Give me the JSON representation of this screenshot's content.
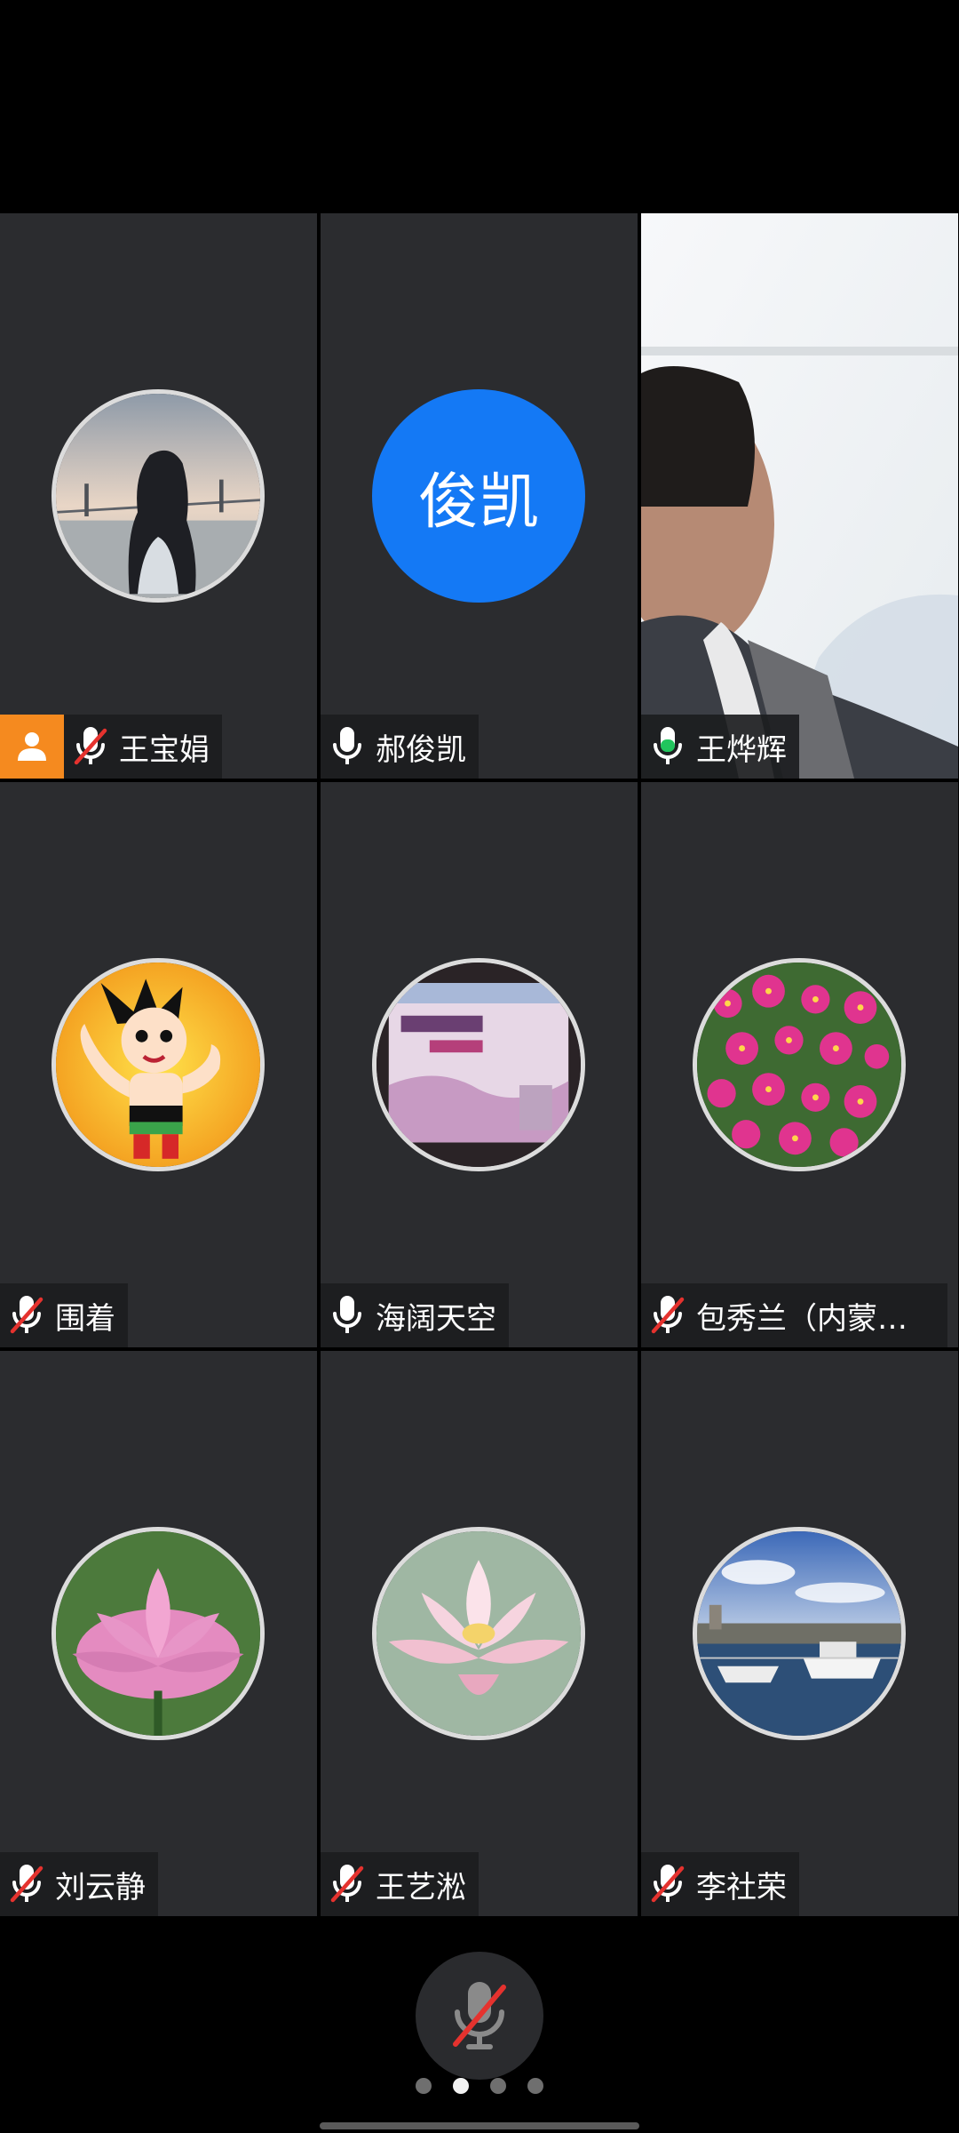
{
  "participants": [
    {
      "name": "王宝娟",
      "mic": "muted",
      "host": true,
      "avatar": "photo-girl-bridge-icon"
    },
    {
      "name": "郝俊凯",
      "mic": "on",
      "host": false,
      "avatar_initials": "俊凯"
    },
    {
      "name": "王烨辉",
      "mic": "speaking",
      "host": false,
      "video": true
    },
    {
      "name": "围着",
      "mic": "muted",
      "host": false,
      "avatar": "cartoon-robot-boy-icon"
    },
    {
      "name": "海阔天空",
      "mic": "on",
      "host": false,
      "avatar": "university-card-icon"
    },
    {
      "name": "包秀兰（内蒙古...",
      "mic": "muted",
      "host": false,
      "avatar": "pink-flowers-icon"
    },
    {
      "name": "刘云静",
      "mic": "muted",
      "host": false,
      "avatar": "lotus-flower-icon"
    },
    {
      "name": "王艺淞",
      "mic": "muted",
      "host": false,
      "avatar": "white-lotus-icon"
    },
    {
      "name": "李社荣",
      "mic": "muted",
      "host": false,
      "avatar": "harbor-boats-icon"
    }
  ],
  "toolbar": {
    "mute_state": "muted",
    "page_count": 4,
    "current_page": 2
  },
  "colors": {
    "host_badge": "#f58a1f",
    "muted_slash": "#e5322e",
    "speaking_mic": "#21c55d",
    "active_border": "#21c55d",
    "initials_bg": "#1479f5"
  }
}
